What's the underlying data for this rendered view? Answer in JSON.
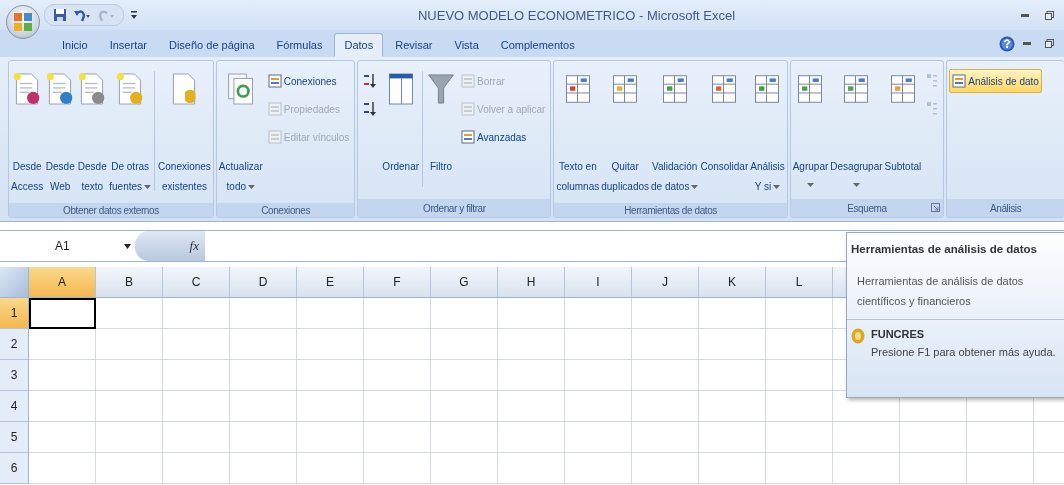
{
  "window": {
    "title": "NUEVO MODELO ECONOMETRICO - Microsoft Excel"
  },
  "tabs": [
    {
      "label": "Inicio",
      "selected": false
    },
    {
      "label": "Insertar",
      "selected": false
    },
    {
      "label": "Diseño de página",
      "selected": false
    },
    {
      "label": "Fórmulas",
      "selected": false
    },
    {
      "label": "Datos",
      "selected": true
    },
    {
      "label": "Revisar",
      "selected": false
    },
    {
      "label": "Vista",
      "selected": false
    },
    {
      "label": "Complementos",
      "selected": false
    }
  ],
  "ribbon": {
    "groups": [
      {
        "label": "Obtener datos externos",
        "launcher": false,
        "items": [
          {
            "kind": "large",
            "lines": [
              "Desde",
              "Access"
            ],
            "dropdown": false
          },
          {
            "kind": "large",
            "lines": [
              "Desde",
              "Web"
            ],
            "dropdown": false
          },
          {
            "kind": "large",
            "lines": [
              "Desde",
              "texto"
            ],
            "dropdown": false
          },
          {
            "kind": "large",
            "lines": [
              "De otras",
              "fuentes"
            ],
            "dropdown": true
          },
          {
            "kind": "separator"
          },
          {
            "kind": "large",
            "lines": [
              "Conexiones",
              "existentes"
            ],
            "dropdown": false
          }
        ]
      },
      {
        "label": "Conexiones",
        "launcher": false,
        "items": [
          {
            "kind": "large",
            "lines": [
              "Actualizar",
              "todo"
            ],
            "dropdown": true
          },
          {
            "kind": "stack",
            "items": [
              {
                "label": "Conexiones",
                "disabled": false,
                "highlighted": false
              },
              {
                "label": "Propiedades",
                "disabled": true,
                "highlighted": false
              },
              {
                "label": "Editar vínculos",
                "disabled": true,
                "highlighted": false
              }
            ]
          }
        ]
      },
      {
        "label": "Ordenar y filtrar",
        "launcher": false,
        "items": [
          {
            "kind": "stack",
            "items": [
              {
                "disabled": false,
                "highlighted": false
              },
              {
                "disabled": false,
                "highlighted": false
              }
            ]
          },
          {
            "kind": "large",
            "lines": [
              "Ordenar"
            ],
            "dropdown": false
          },
          {
            "kind": "separator"
          },
          {
            "kind": "large",
            "lines": [
              "Filtro"
            ],
            "dropdown": false
          },
          {
            "kind": "stack",
            "items": [
              {
                "label": "Borrar",
                "disabled": true,
                "highlighted": false
              },
              {
                "label": "Volver a aplicar",
                "disabled": true,
                "highlighted": false
              },
              {
                "label": "Avanzadas",
                "disabled": false,
                "highlighted": false
              }
            ]
          }
        ]
      },
      {
        "label": "Herramientas de datos",
        "launcher": false,
        "items": [
          {
            "kind": "large",
            "lines": [
              "Texto en",
              "columnas"
            ],
            "dropdown": false
          },
          {
            "kind": "large",
            "lines": [
              "Quitar",
              "duplicados"
            ],
            "dropdown": false
          },
          {
            "kind": "large",
            "lines": [
              "Validación",
              "de datos"
            ],
            "dropdown": true
          },
          {
            "kind": "large",
            "lines": [
              "Consolidar"
            ],
            "dropdown": false
          },
          {
            "kind": "large",
            "lines": [
              "Análisis",
              "Y si"
            ],
            "dropdown": true
          }
        ]
      },
      {
        "label": "Esquema",
        "launcher": true,
        "items": [
          {
            "kind": "large",
            "lines": [
              "Agrupar"
            ],
            "dropdown": true
          },
          {
            "kind": "large",
            "lines": [
              "Desagrupar"
            ],
            "dropdown": true
          },
          {
            "kind": "large",
            "lines": [
              "Subtotal"
            ],
            "dropdown": false
          },
          {
            "kind": "stack",
            "items": [
              {
                "disabled": true,
                "highlighted": false
              },
              {
                "disabled": true,
                "highlighted": false
              }
            ]
          }
        ]
      },
      {
        "label": "Análisis",
        "launcher": false,
        "items": [
          {
            "kind": "stack",
            "items": [
              {
                "label": "Análisis de dato",
                "disabled": false,
                "highlighted": true
              }
            ]
          }
        ]
      }
    ]
  },
  "formula_bar": {
    "name_box": "A1",
    "fx": "fx"
  },
  "grid": {
    "columns": [
      {
        "label": "A",
        "selected": true
      },
      {
        "label": "B",
        "selected": false
      },
      {
        "label": "C",
        "selected": false
      },
      {
        "label": "D",
        "selected": false
      },
      {
        "label": "E",
        "selected": false
      },
      {
        "label": "F",
        "selected": false
      },
      {
        "label": "G",
        "selected": false
      },
      {
        "label": "H",
        "selected": false
      },
      {
        "label": "I",
        "selected": false
      },
      {
        "label": "J",
        "selected": false
      },
      {
        "label": "K",
        "selected": false
      },
      {
        "label": "L",
        "selected": false
      }
    ],
    "rows": [
      {
        "label": "1",
        "selected": true
      },
      {
        "label": "2",
        "selected": false
      },
      {
        "label": "3",
        "selected": false
      },
      {
        "label": "4",
        "selected": false
      },
      {
        "label": "5",
        "selected": false
      },
      {
        "label": "6",
        "selected": false
      }
    ]
  },
  "tooltip": {
    "title": "Herramientas de análisis de datos",
    "description": "Herramientas de análisis de datos científicos y financieros",
    "addin": "FUNCRES",
    "help": "Presione F1 para obtener más ayuda."
  }
}
